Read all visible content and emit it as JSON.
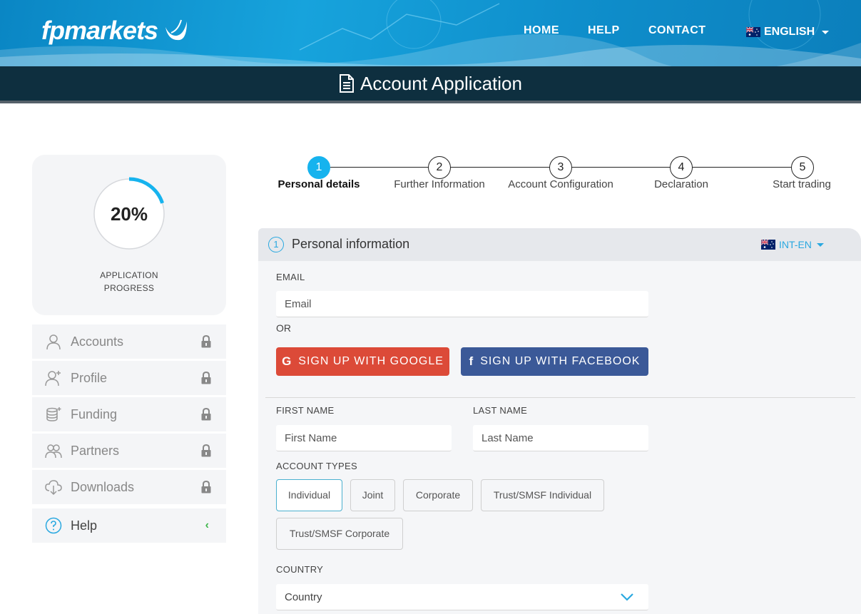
{
  "header": {
    "logo": "fpmarkets",
    "nav": [
      "HOME",
      "HELP",
      "CONTACT"
    ],
    "language": "ENGLISH"
  },
  "title": "Account Application",
  "progress": {
    "percent_label": "20%",
    "fraction": 0.2,
    "label_line1": "APPLICATION",
    "label_line2": "PROGRESS"
  },
  "sidebar": {
    "items": [
      {
        "label": "Accounts",
        "icon": "user-icon",
        "locked": true
      },
      {
        "label": "Profile",
        "icon": "user-plus-icon",
        "locked": true
      },
      {
        "label": "Funding",
        "icon": "coins-icon",
        "locked": true
      },
      {
        "label": "Partners",
        "icon": "users-icon",
        "locked": true
      },
      {
        "label": "Downloads",
        "icon": "cloud-download-icon",
        "locked": true
      },
      {
        "label": "Help",
        "icon": "help-icon",
        "locked": false
      }
    ]
  },
  "steps": [
    {
      "num": "1",
      "label": "Personal details",
      "active": true
    },
    {
      "num": "2",
      "label": "Further Information",
      "active": false
    },
    {
      "num": "3",
      "label": "Account Configuration",
      "active": false
    },
    {
      "num": "4",
      "label": "Declaration",
      "active": false
    },
    {
      "num": "5",
      "label": "Start trading",
      "active": false
    }
  ],
  "form": {
    "section_num": "1",
    "section_title": "Personal information",
    "locale": "INT-EN",
    "email_label": "EMAIL",
    "email_placeholder": "Email",
    "or": "OR",
    "google_label": "SIGN UP WITH GOOGLE",
    "facebook_label": "SIGN UP WITH FACEBOOK",
    "first_name_label": "FIRST NAME",
    "first_name_placeholder": "First Name",
    "last_name_label": "LAST NAME",
    "last_name_placeholder": "Last Name",
    "account_types_label": "ACCOUNT TYPES",
    "account_types": [
      "Individual",
      "Joint",
      "Corporate",
      "Trust/SMSF Individual",
      "Trust/SMSF Corporate"
    ],
    "account_type_selected": "Individual",
    "country_label": "COUNTRY",
    "country_value": "Country"
  },
  "colors": {
    "header_blue": "#17a3dc",
    "titlebar": "#0e2f3f",
    "accent": "#16b3ee",
    "google": "#dc4a38",
    "facebook": "#3b5998",
    "help_chevron": "#3cb54a"
  }
}
